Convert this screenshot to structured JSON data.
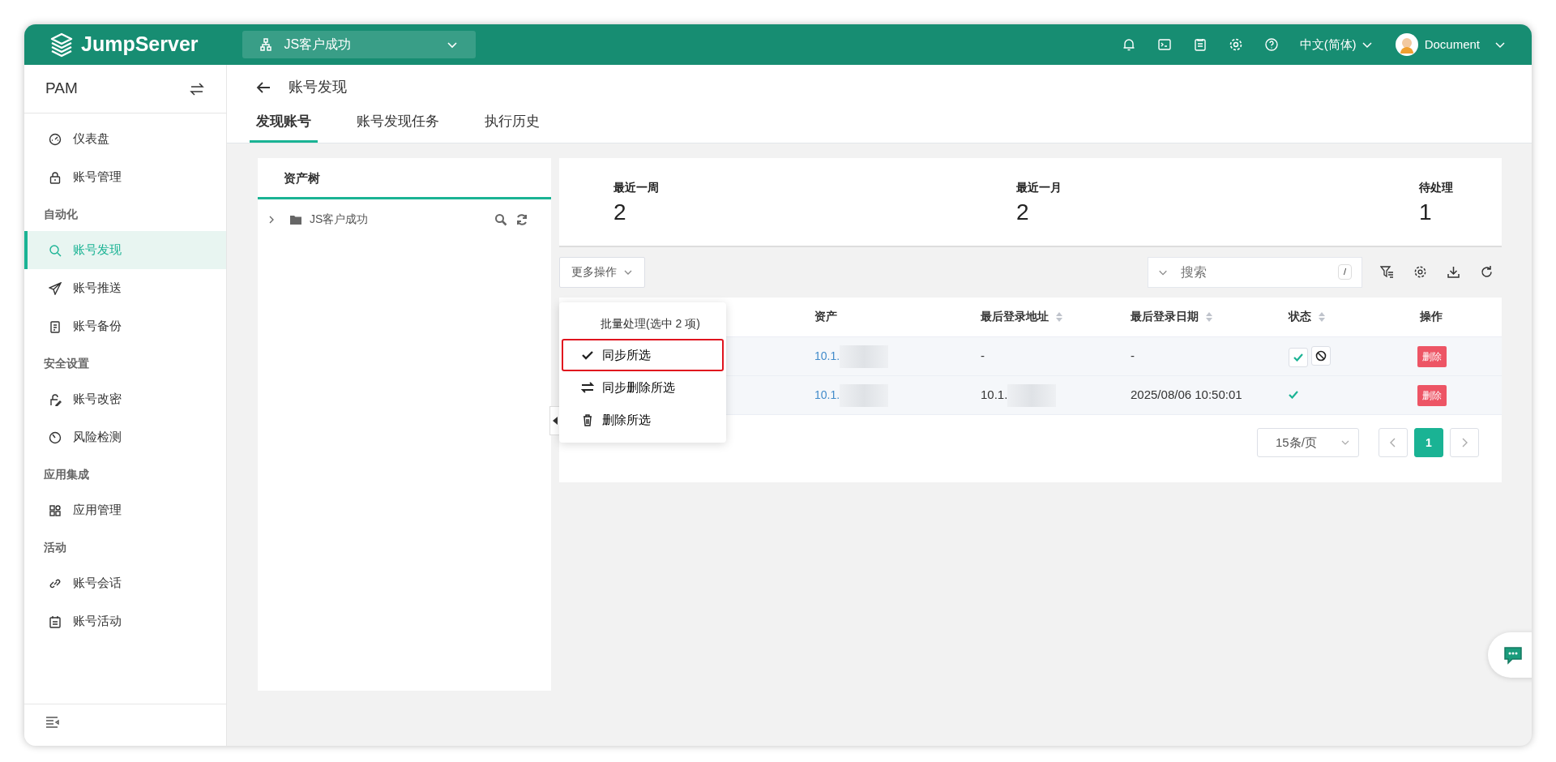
{
  "header": {
    "logo": "JumpServer",
    "org": "JS客户成功",
    "language": "中文(简体)",
    "user": "Document"
  },
  "sidebar": {
    "title": "PAM",
    "items": [
      {
        "kind": "item",
        "label": "仪表盘",
        "selected": false
      },
      {
        "kind": "item",
        "label": "账号管理",
        "selected": false
      },
      {
        "kind": "section",
        "label": "自动化"
      },
      {
        "kind": "item",
        "label": "账号发现",
        "selected": true
      },
      {
        "kind": "item",
        "label": "账号推送",
        "selected": false
      },
      {
        "kind": "item",
        "label": "账号备份",
        "selected": false
      },
      {
        "kind": "section",
        "label": "安全设置"
      },
      {
        "kind": "item",
        "label": "账号改密",
        "selected": false
      },
      {
        "kind": "item",
        "label": "风险检测",
        "selected": false
      },
      {
        "kind": "section",
        "label": "应用集成"
      },
      {
        "kind": "item",
        "label": "应用管理",
        "selected": false
      },
      {
        "kind": "section",
        "label": "活动"
      },
      {
        "kind": "item",
        "label": "账号会话",
        "selected": false
      },
      {
        "kind": "item",
        "label": "账号活动",
        "selected": false
      }
    ]
  },
  "page": {
    "title": "账号发现",
    "tabs": [
      {
        "label": "发现账号",
        "selected": true
      },
      {
        "label": "账号发现任务",
        "selected": false
      },
      {
        "label": "执行历史",
        "selected": false
      }
    ]
  },
  "tree": {
    "tab": "资产树",
    "nodes": [
      {
        "label": "JS客户成功",
        "expanded": false
      }
    ]
  },
  "stats": [
    {
      "label": "最近一周",
      "value": "2"
    },
    {
      "label": "最近一月",
      "value": "2"
    },
    {
      "label": "待处理",
      "value": "1"
    }
  ],
  "toolbar": {
    "more": "更多操作",
    "search_placeholder": "搜索",
    "shortcut": "/"
  },
  "table": {
    "columns": [
      {
        "label": "资产",
        "sortable": false
      },
      {
        "label": "最后登录地址",
        "sortable": true
      },
      {
        "label": "最后登录日期",
        "sortable": true
      },
      {
        "label": "状态",
        "sortable": true
      },
      {
        "label": "操作",
        "sortable": false
      }
    ],
    "rows": [
      {
        "asset": "10.1.",
        "address": "-",
        "date": "-",
        "confirmed": false,
        "action": "删除"
      },
      {
        "asset": "10.1.",
        "address": "10.1.",
        "date": "2025/08/06 10:50:01",
        "confirmed": true,
        "action": "删除"
      }
    ]
  },
  "pagination": {
    "page_size": "15条/页",
    "pages": [
      {
        "label": "1",
        "selected": true
      }
    ]
  },
  "dropdown": {
    "title": "批量处理(选中 2 项)",
    "items": [
      {
        "label": "同步所选",
        "highlighted": true
      },
      {
        "label": "同步删除所选",
        "highlighted": false
      },
      {
        "label": "删除所选",
        "highlighted": false
      }
    ]
  }
}
